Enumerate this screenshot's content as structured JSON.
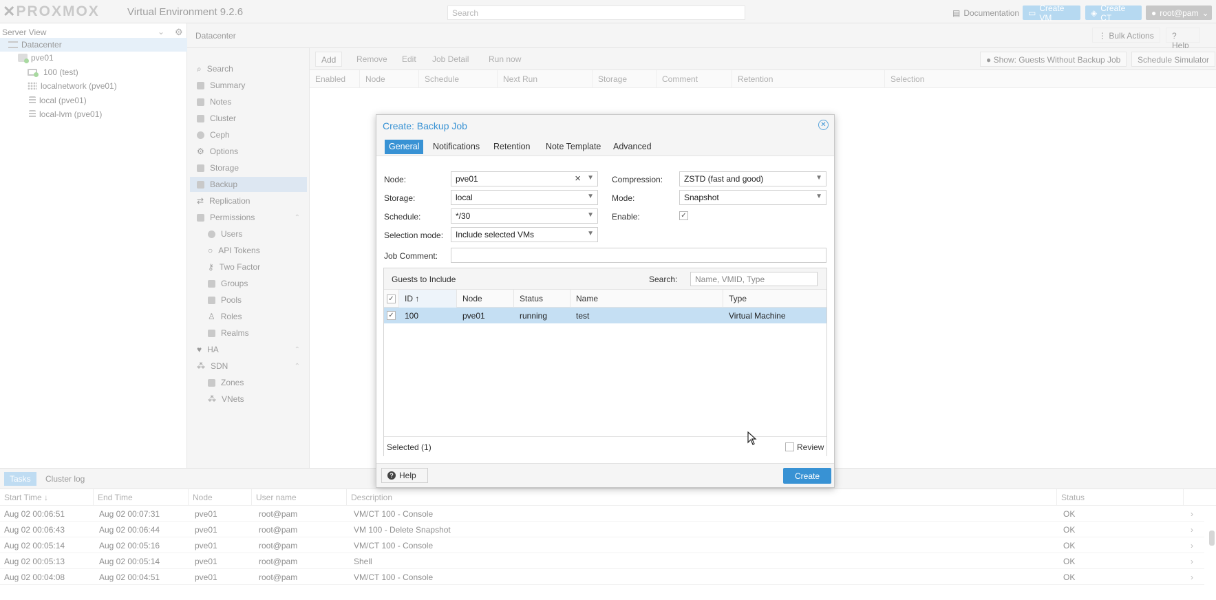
{
  "topbar": {
    "logo": "PROXMOX",
    "product": "Virtual Environment 9.2.6",
    "search_placeholder": "Search",
    "documentation": "Documentation",
    "create_vm": "Create VM",
    "create_ct": "Create CT",
    "user": "root@pam"
  },
  "tree": {
    "view": "Server View",
    "items": [
      {
        "label": "Datacenter"
      },
      {
        "label": "pve01"
      },
      {
        "label": "100 (test)"
      },
      {
        "label": "localnetwork (pve01)"
      },
      {
        "label": "local (pve01)"
      },
      {
        "label": "local-lvm (pve01)"
      }
    ]
  },
  "datacenter": {
    "title": "Datacenter",
    "bulk_actions": "Bulk Actions",
    "help": "Help",
    "menu": [
      {
        "label": "Search"
      },
      {
        "label": "Summary"
      },
      {
        "label": "Notes"
      },
      {
        "label": "Cluster"
      },
      {
        "label": "Ceph"
      },
      {
        "label": "Options"
      },
      {
        "label": "Storage"
      },
      {
        "label": "Backup"
      },
      {
        "label": "Replication"
      },
      {
        "label": "Permissions"
      },
      {
        "label": "Users"
      },
      {
        "label": "API Tokens"
      },
      {
        "label": "Two Factor"
      },
      {
        "label": "Groups"
      },
      {
        "label": "Pools"
      },
      {
        "label": "Roles"
      },
      {
        "label": "Realms"
      },
      {
        "label": "HA"
      },
      {
        "label": "SDN"
      },
      {
        "label": "Zones"
      },
      {
        "label": "VNets"
      }
    ]
  },
  "backup": {
    "toolbar": {
      "add": "Add",
      "remove": "Remove",
      "edit": "Edit",
      "job_detail": "Job Detail",
      "run_now": "Run now",
      "show_guests": "Show: Guests Without Backup Job",
      "schedule_simulator": "Schedule Simulator"
    },
    "columns": [
      "Enabled",
      "Node",
      "Schedule",
      "Next Run",
      "Storage",
      "Comment",
      "Retention",
      "Selection"
    ]
  },
  "dialog": {
    "title": "Create: Backup Job",
    "tabs": [
      "General",
      "Notifications",
      "Retention",
      "Note Template",
      "Advanced"
    ],
    "node_label": "Node:",
    "node_value": "pve01",
    "storage_label": "Storage:",
    "storage_value": "local",
    "schedule_label": "Schedule:",
    "schedule_value": "*/30",
    "selection_mode_label": "Selection mode:",
    "selection_mode_value": "Include selected VMs",
    "compression_label": "Compression:",
    "compression_value": "ZSTD (fast and good)",
    "mode_label": "Mode:",
    "mode_value": "Snapshot",
    "enable_label": "Enable:",
    "enable_checked": true,
    "job_comment_label": "Job Comment:",
    "job_comment_value": "",
    "guests": {
      "title": "Guests to Include",
      "search_label": "Search:",
      "search_placeholder": "Name, VMID, Type",
      "columns": [
        "ID",
        "Node",
        "Status",
        "Name",
        "Type"
      ],
      "rows": [
        {
          "id": "100",
          "node": "pve01",
          "status": "running",
          "name": "test",
          "type": "Virtual Machine"
        }
      ],
      "selected_text": "Selected (1)",
      "review_label": "Review"
    },
    "help_label": "Help",
    "create_label": "Create"
  },
  "tasks": {
    "tabs": [
      "Tasks",
      "Cluster log"
    ],
    "columns": [
      "Start Time",
      "End Time",
      "Node",
      "User name",
      "Description",
      "Status"
    ],
    "rows": [
      {
        "start": "Aug 02 00:06:51",
        "end": "Aug 02 00:07:31",
        "node": "pve01",
        "user": "root@pam",
        "desc": "VM/CT 100 - Console",
        "status": "OK"
      },
      {
        "start": "Aug 02 00:06:43",
        "end": "Aug 02 00:06:44",
        "node": "pve01",
        "user": "root@pam",
        "desc": "VM 100 - Delete Snapshot",
        "status": "OK"
      },
      {
        "start": "Aug 02 00:05:14",
        "end": "Aug 02 00:05:16",
        "node": "pve01",
        "user": "root@pam",
        "desc": "VM/CT 100 - Console",
        "status": "OK"
      },
      {
        "start": "Aug 02 00:05:13",
        "end": "Aug 02 00:05:14",
        "node": "pve01",
        "user": "root@pam",
        "desc": "Shell",
        "status": "OK"
      },
      {
        "start": "Aug 02 00:04:08",
        "end": "Aug 02 00:04:51",
        "node": "pve01",
        "user": "root@pam",
        "desc": "VM/CT 100 - Console",
        "status": "OK"
      }
    ]
  },
  "colors": {
    "accent": "#3892d4",
    "selected_row": "#c5dff3"
  }
}
